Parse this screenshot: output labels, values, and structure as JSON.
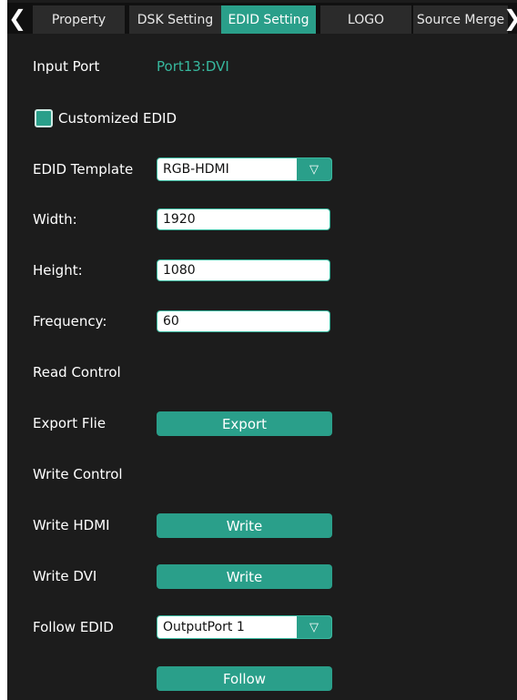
{
  "tabs": {
    "items": [
      "Property",
      "DSK Setting",
      "EDID Setting",
      "LOGO",
      "Source Merge"
    ],
    "active": "EDID Setting"
  },
  "input_port": {
    "label": "Input Port",
    "value": "Port13:DVI"
  },
  "customized_edid": {
    "label": "Customized EDID",
    "checked": true
  },
  "edid_template": {
    "label": "EDID Template",
    "value": "RGB-HDMI"
  },
  "width": {
    "label": "Width:",
    "value": "1920"
  },
  "height": {
    "label": "Height:",
    "value": "1080"
  },
  "frequency": {
    "label": "Frequency:",
    "value": "60"
  },
  "read_control": {
    "label": "Read Control"
  },
  "export_file": {
    "label": "Export Flie",
    "button": "Export"
  },
  "write_control": {
    "label": "Write Control"
  },
  "write_hdmi": {
    "label": "Write HDMI",
    "button": "Write"
  },
  "write_dvi": {
    "label": "Write DVI",
    "button": "Write"
  },
  "follow_edid": {
    "label": "Follow EDID",
    "value": "OutputPort 1",
    "button": "Follow"
  },
  "icons": {
    "dropdown": "▽",
    "left": "❮",
    "right": "❯"
  },
  "colors": {
    "accent": "#2a9f8a",
    "accent_text": "#37b89e",
    "background": "#1c1c1c"
  }
}
